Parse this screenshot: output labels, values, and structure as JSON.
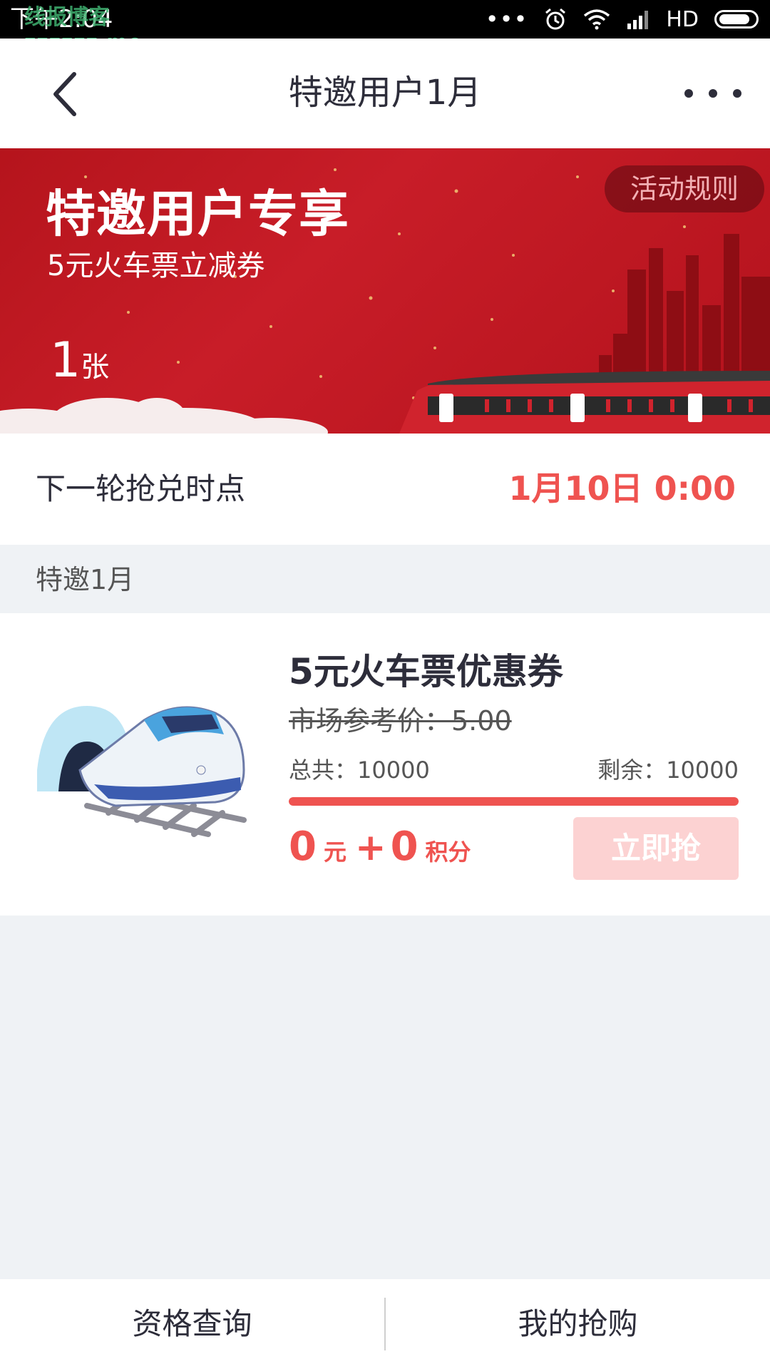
{
  "status_bar": {
    "time": "下午2:04",
    "watermark": "线报博客",
    "watermark_url": "zzzzzz.me",
    "dots": "•••",
    "network": "HD"
  },
  "nav": {
    "title": "特邀用户1月"
  },
  "banner": {
    "title": "特邀用户专享",
    "subtitle": "5元火车票立减券",
    "count_number": "1",
    "count_unit": "张",
    "rules_label": "活动规则"
  },
  "next_round": {
    "label": "下一轮抢兑时点",
    "time": "1月10日 0:00"
  },
  "section": {
    "title": "特邀1月"
  },
  "product": {
    "name": "5元火车票优惠券",
    "market_price": "市场参考价：5.00",
    "total": "总共：10000",
    "remaining": "剩余：10000",
    "remaining_fraction": 1.0,
    "price_yuan": "0",
    "yuan_unit": "元",
    "plus": "+",
    "price_points": "0",
    "points_unit": "积分",
    "button_label": "立即抢"
  },
  "bottom_tabs": {
    "left": "资格查询",
    "right": "我的抢购"
  },
  "colors": {
    "accent_red": "#ef5350",
    "banner_red": "#c81d28",
    "button_disabled": "#fcd2d2",
    "page_bg": "#eff2f5"
  }
}
